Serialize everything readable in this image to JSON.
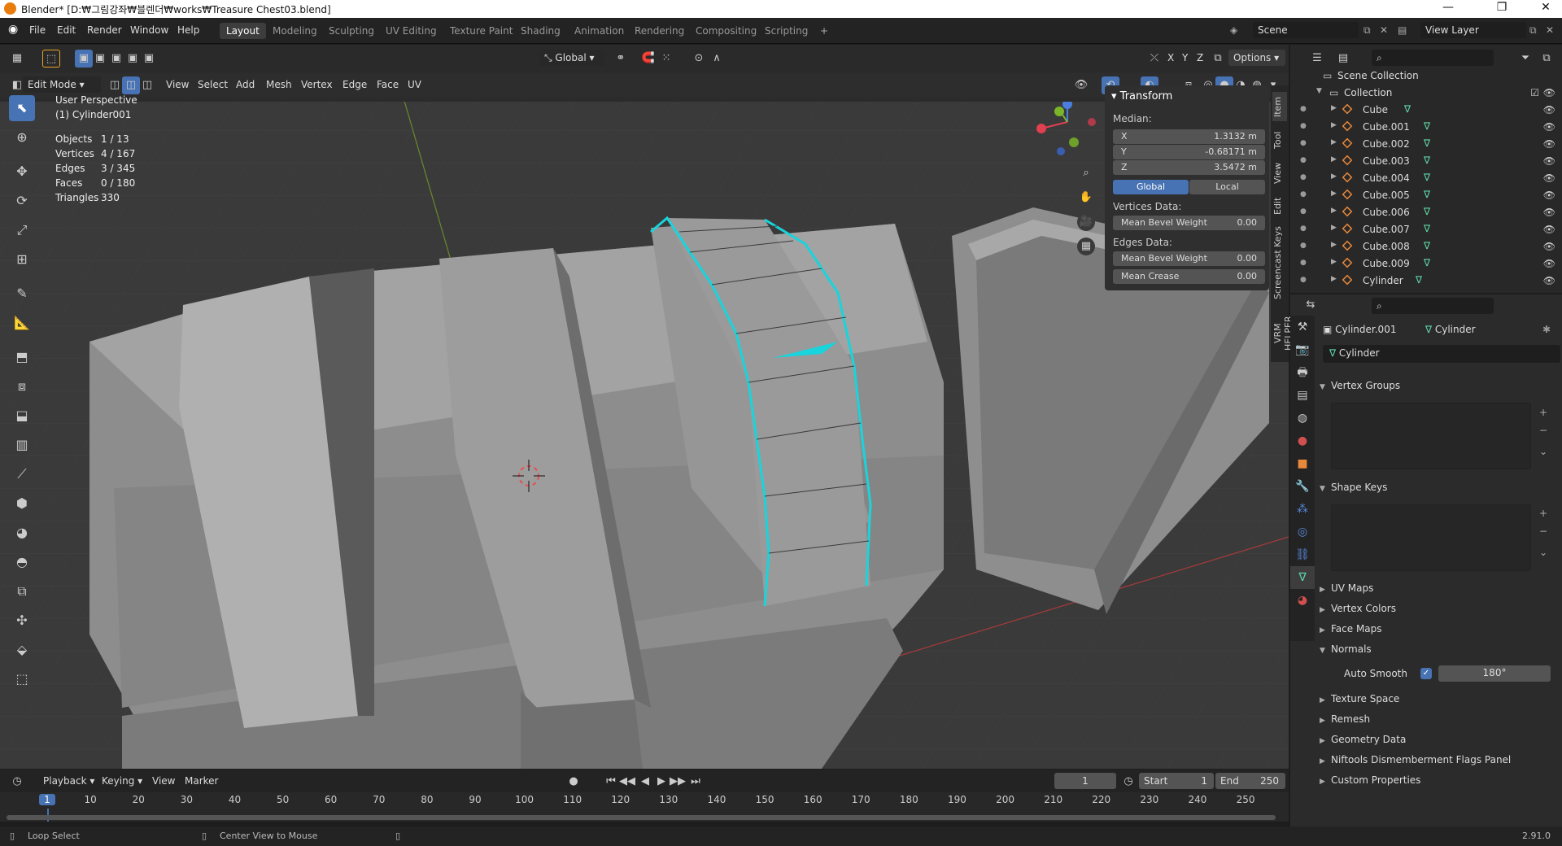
{
  "window": {
    "title": "Blender* [D:₩그림강좌₩블렌더₩works₩Treasure Chest03.blend]",
    "min": "—",
    "max": "❐",
    "close": "✕"
  },
  "menu": [
    "File",
    "Edit",
    "Render",
    "Window",
    "Help"
  ],
  "workspaces": [
    "Layout",
    "Modeling",
    "Sculpting",
    "UV Editing",
    "Texture Paint",
    "Shading",
    "Animation",
    "Rendering",
    "Compositing",
    "Scripting"
  ],
  "scene": {
    "name": "Scene",
    "view_layer": "View Layer"
  },
  "viewport_header": {
    "mode": "Edit Mode",
    "menus": [
      "View",
      "Select",
      "Add",
      "Mesh",
      "Vertex",
      "Edge",
      "Face",
      "UV"
    ],
    "transform_orientation": "Global",
    "options": "Options",
    "axes": [
      "X",
      "Y",
      "Z"
    ]
  },
  "info": {
    "perspective": "User Perspective",
    "object": "(1) Cylinder001",
    "stats": [
      {
        "k": "Objects",
        "v": "1 / 13"
      },
      {
        "k": "Vertices",
        "v": "4 / 167"
      },
      {
        "k": "Edges",
        "v": "3 / 345"
      },
      {
        "k": "Faces",
        "v": "0 / 180"
      },
      {
        "k": "Triangles",
        "v": "330"
      }
    ]
  },
  "npanel": {
    "title": "Transform",
    "median_label": "Median:",
    "x_label": "X",
    "x": "1.3132 m",
    "y_label": "Y",
    "y": "-0.68171 m",
    "z_label": "Z",
    "z": "3.5472 m",
    "global": "Global",
    "local": "Local",
    "vertices_data": "Vertices Data:",
    "edges_data": "Edges Data:",
    "mean_bevel_weight": "Mean Bevel Weight",
    "vbw": "0.00",
    "ebw": "0.00",
    "mean_crease": "Mean Crease",
    "crease": "0.00",
    "tabs": [
      "Item",
      "Tool",
      "View",
      "Edit",
      "Screencast Keys",
      "VRM HELPER"
    ]
  },
  "outliner": {
    "root": "Scene Collection",
    "collection": "Collection",
    "items": [
      "Cube",
      "Cube.001",
      "Cube.002",
      "Cube.003",
      "Cube.004",
      "Cube.005",
      "Cube.006",
      "Cube.007",
      "Cube.008",
      "Cube.009",
      "Cylinder"
    ]
  },
  "properties": {
    "object": "Cylinder.001",
    "mesh": "Cylinder",
    "datablock": "Cylinder",
    "sections": {
      "vertex_groups": "Vertex Groups",
      "shape_keys": "Shape Keys",
      "uv_maps": "UV Maps",
      "vertex_colors": "Vertex Colors",
      "face_maps": "Face Maps",
      "normals": "Normals",
      "texture_space": "Texture Space",
      "remesh": "Remesh",
      "geometry_data": "Geometry Data",
      "niftools": "Niftools Dismemberment Flags Panel",
      "custom_properties": "Custom Properties"
    },
    "auto_smooth": "Auto Smooth",
    "angle": "180°"
  },
  "timeline": {
    "menus": [
      "Playback",
      "Keying",
      "View",
      "Marker"
    ],
    "current": "1",
    "start_label": "Start",
    "start": "1",
    "end_label": "End",
    "end": "250",
    "ticks": [
      "1",
      "10",
      "20",
      "30",
      "40",
      "50",
      "60",
      "70",
      "80",
      "90",
      "100",
      "110",
      "120",
      "130",
      "140",
      "150",
      "160",
      "170",
      "180",
      "190",
      "200",
      "210",
      "220",
      "230",
      "240",
      "250"
    ]
  },
  "status": {
    "left": "Loop Select",
    "mid": "Center View to Mouse",
    "version": "2.91.0"
  },
  "colors": {
    "accent": "#4772b3",
    "selection": "#19d4dc",
    "header": "#232323"
  }
}
